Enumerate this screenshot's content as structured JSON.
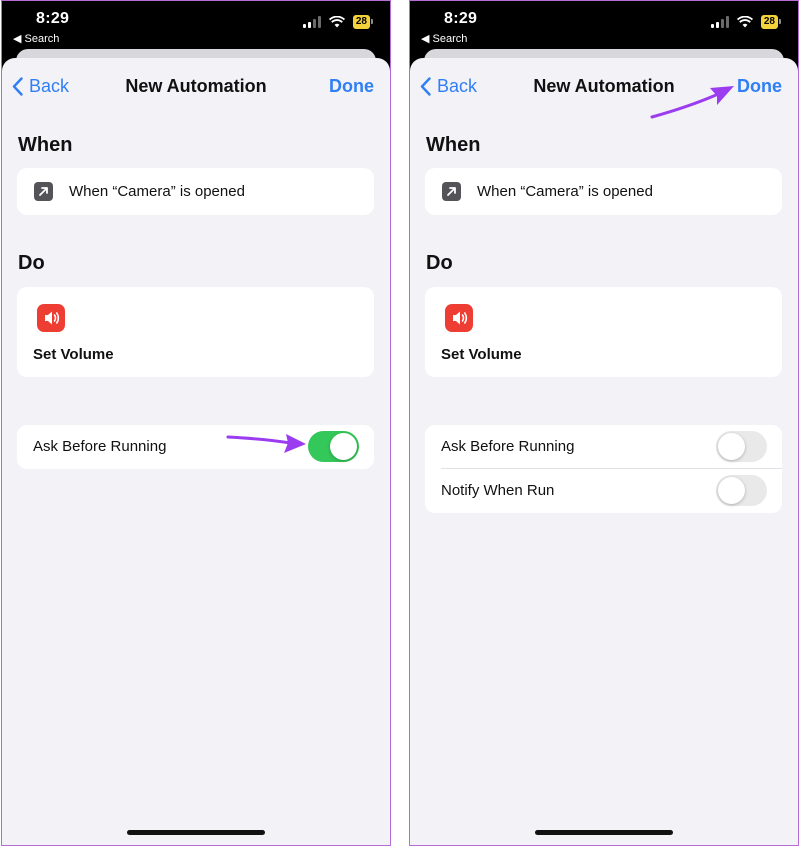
{
  "status_bar": {
    "time": "8:29",
    "back_label": "◀ Search",
    "battery": "28"
  },
  "nav": {
    "back_label": "Back",
    "title": "New Automation",
    "done_label": "Done"
  },
  "when": {
    "header": "When",
    "trigger": "When “Camera” is opened"
  },
  "do": {
    "header": "Do",
    "action": "Set Volume"
  },
  "left_screen": {
    "toggles": [
      {
        "label": "Ask Before Running",
        "on": true
      }
    ]
  },
  "right_screen": {
    "toggles": [
      {
        "label": "Ask Before Running",
        "on": false
      },
      {
        "label": "Notify When Run",
        "on": false
      }
    ]
  },
  "colors": {
    "accent": "#2f7ff5",
    "toggle_on": "#34c759",
    "annotation_arrow": "#9b3cf0",
    "volume_icon": "#ee3d33",
    "battery": "#f3d23b"
  },
  "icons": [
    "chevron-left-icon",
    "arrow-up-right-icon",
    "speaker-icon",
    "wifi-icon",
    "signal-icon",
    "battery-icon"
  ]
}
